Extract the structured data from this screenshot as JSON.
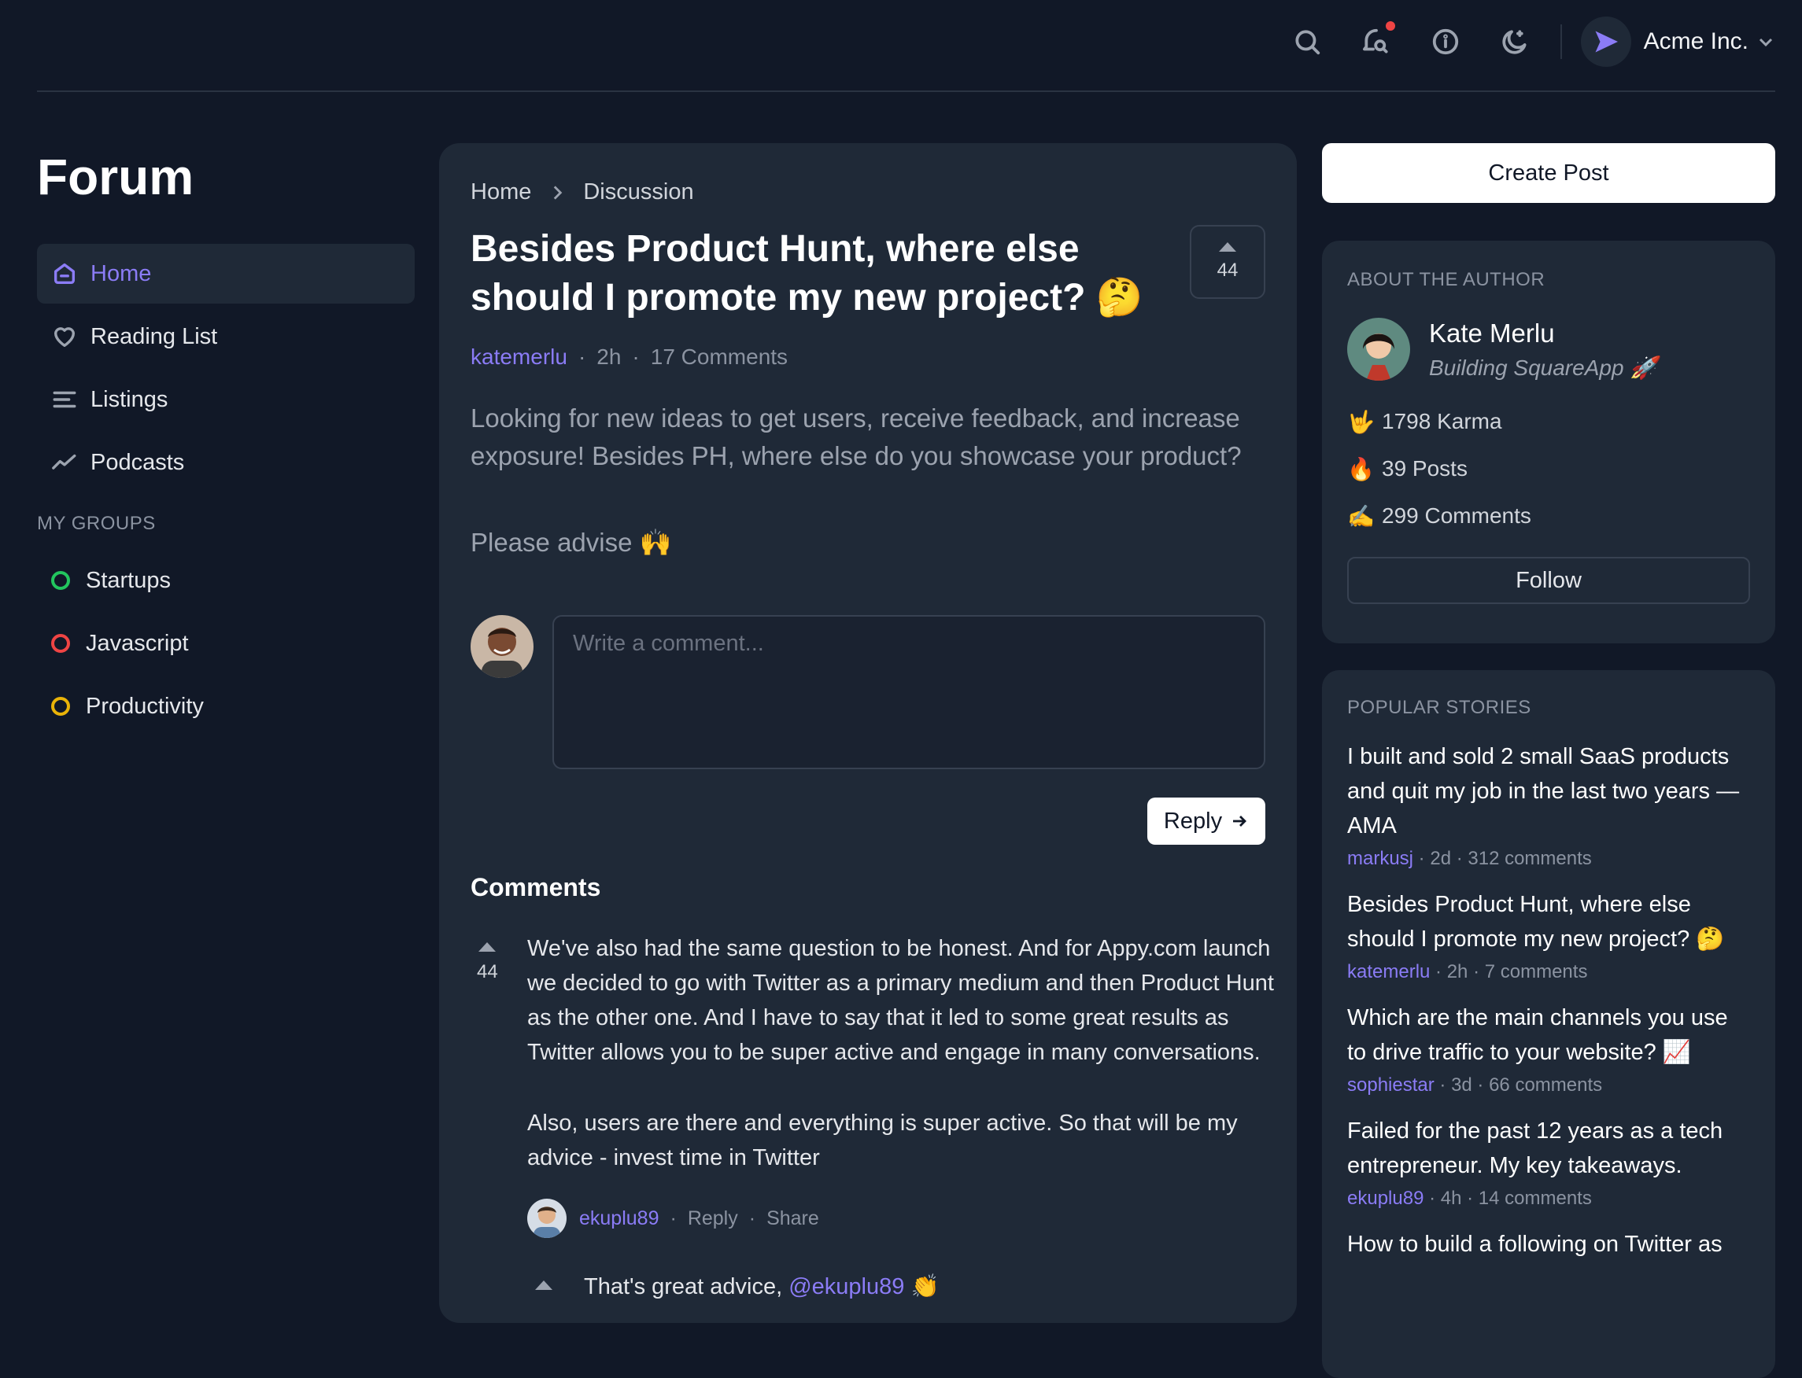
{
  "header": {
    "account_name": "Acme Inc.",
    "icons": [
      "search-icon",
      "notification-icon",
      "info-icon",
      "dark-mode-icon"
    ],
    "notification_dot_color": "#ef4444"
  },
  "sidebar": {
    "title": "Forum",
    "nav": [
      {
        "label": "Home",
        "icon": "home-icon",
        "active": true
      },
      {
        "label": "Reading List",
        "icon": "heart-icon"
      },
      {
        "label": "Listings",
        "icon": "list-icon"
      },
      {
        "label": "Podcasts",
        "icon": "trend-icon"
      }
    ],
    "groups_heading": "MY GROUPS",
    "groups": [
      {
        "label": "Startups",
        "color": "#22c55e"
      },
      {
        "label": "Javascript",
        "color": "#ef4444"
      },
      {
        "label": "Productivity",
        "color": "#eab308"
      }
    ]
  },
  "post": {
    "breadcrumb": [
      "Home",
      "Discussion"
    ],
    "title": "Besides Product Hunt, where else should I promote my new project? 🤔",
    "votes": "44",
    "author": "katemerlu",
    "time": "2h",
    "comments_count": "17 Comments",
    "body": [
      "Looking for new ideas to get users, receive feedback, and increase exposure! Besides PH, where else do you showcase your product?",
      "Please advise 🙌"
    ],
    "comment_placeholder": "Write a comment...",
    "reply_label": "Reply"
  },
  "comments": {
    "heading": "Comments",
    "items": [
      {
        "votes": "44",
        "paragraphs": [
          "We've also had the same question to be honest. And for Appy.com launch we decided to go with Twitter as a primary medium and then Product Hunt as the other one. And I have to say that it led to some great results as Twitter allows you to be super active and engage in many conversations.",
          "Also, users are there and everything is super active. So that will be my advice - invest time in Twitter"
        ],
        "author": "ekuplu89",
        "reply": "Reply",
        "share": "Share"
      }
    ],
    "nested": {
      "text_before": "That's great advice, ",
      "mention": "@ekuplu89",
      "text_after": " 👏"
    }
  },
  "right": {
    "create_post": "Create Post",
    "about": {
      "heading": "ABOUT THE AUTHOR",
      "name": "Kate Merlu",
      "bio": "Building SquareApp 🚀",
      "stats": [
        {
          "emoji": "🤟",
          "text": "1798 Karma"
        },
        {
          "emoji": "🔥",
          "text": "39 Posts"
        },
        {
          "emoji": "✍️",
          "text": "299 Comments"
        }
      ],
      "follow": "Follow"
    },
    "popular": {
      "heading": "POPULAR STORIES",
      "stories": [
        {
          "title": "I built and sold 2 small SaaS products and quit my job in the last two years — AMA",
          "author": "markusj",
          "meta": " · 2d · 312 comments"
        },
        {
          "title": "Besides Product Hunt, where else should I promote my new project? 🤔",
          "author": "katemerlu",
          "meta": " · 2h · 7 comments"
        },
        {
          "title": "Which are the main channels you use to drive traffic to your website? 📈",
          "author": "sophiestar",
          "meta": " · 3d · 66 comments"
        },
        {
          "title": "Failed for the past 12 years as a tech entrepreneur. My key takeaways.",
          "author": "ekuplu89",
          "meta": " · 4h · 14 comments"
        },
        {
          "title": "How to build a following on Twitter as"
        }
      ]
    }
  },
  "colors": {
    "background": "#111827",
    "panel": "#1f2937",
    "accent": "#8b7cf6"
  }
}
